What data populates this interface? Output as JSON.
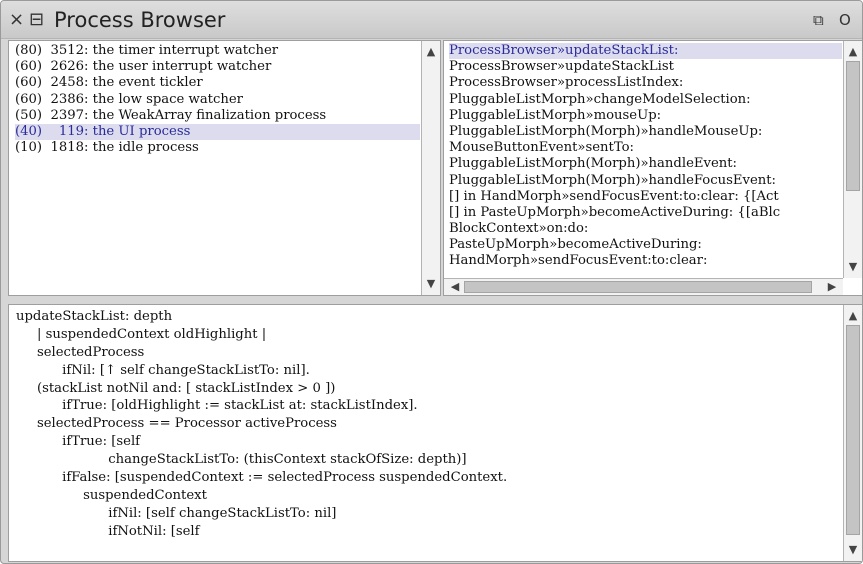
{
  "window": {
    "title": "Process Browser",
    "close_glyph": "×",
    "menu_glyph": "⊟",
    "collapse_glyph": "⧉",
    "expand_glyph": "O"
  },
  "process_list": {
    "selected_index": 5,
    "items": [
      "(80)  3512: the timer interrupt watcher",
      "(60)  2626: the user interrupt watcher",
      "(60)  2458: the event tickler",
      "(60)  2386: the low space watcher",
      "(50)  2397: the WeakArray finalization process",
      "(40)    119: the UI process",
      "(10)  1818: the idle process"
    ]
  },
  "stack_list": {
    "selected_index": 0,
    "items": [
      "ProcessBrowser»updateStackList:",
      "ProcessBrowser»updateStackList",
      "ProcessBrowser»processListIndex:",
      "PluggableListMorph»changeModelSelection:",
      "PluggableListMorph»mouseUp:",
      "PluggableListMorph(Morph)»handleMouseUp:",
      "MouseButtonEvent»sentTo:",
      "PluggableListMorph(Morph)»handleEvent:",
      "PluggableListMorph(Morph)»handleFocusEvent:",
      "[] in HandMorph»sendFocusEvent:to:clear: {[Act",
      "[] in PasteUpMorph»becomeActiveDuring: {[aBlc",
      "BlockContext»on:do:",
      "PasteUpMorph»becomeActiveDuring:",
      "HandMorph»sendFocusEvent:to:clear:"
    ]
  },
  "source_code": {
    "lines": [
      "updateStackList: depth",
      "     | suspendedContext oldHighlight |",
      "     selectedProcess",
      "           ifNil: [↑ self changeStackListTo: nil].",
      "     (stackList notNil and: [ stackListIndex > 0 ])",
      "           ifTrue: [oldHighlight := stackList at: stackListIndex].",
      "     selectedProcess == Processor activeProcess",
      "           ifTrue: [self",
      "                      changeStackListTo: (thisContext stackOfSize: depth)]",
      "           ifFalse: [suspendedContext := selectedProcess suspendedContext.",
      "                suspendedContext",
      "                      ifNil: [self changeStackListTo: nil]",
      "                      ifNotNil: [self"
    ]
  },
  "scroll": {
    "up_arrow": "▲",
    "down_arrow": "▼",
    "left_arrow": "◀",
    "right_arrow": "▶"
  }
}
